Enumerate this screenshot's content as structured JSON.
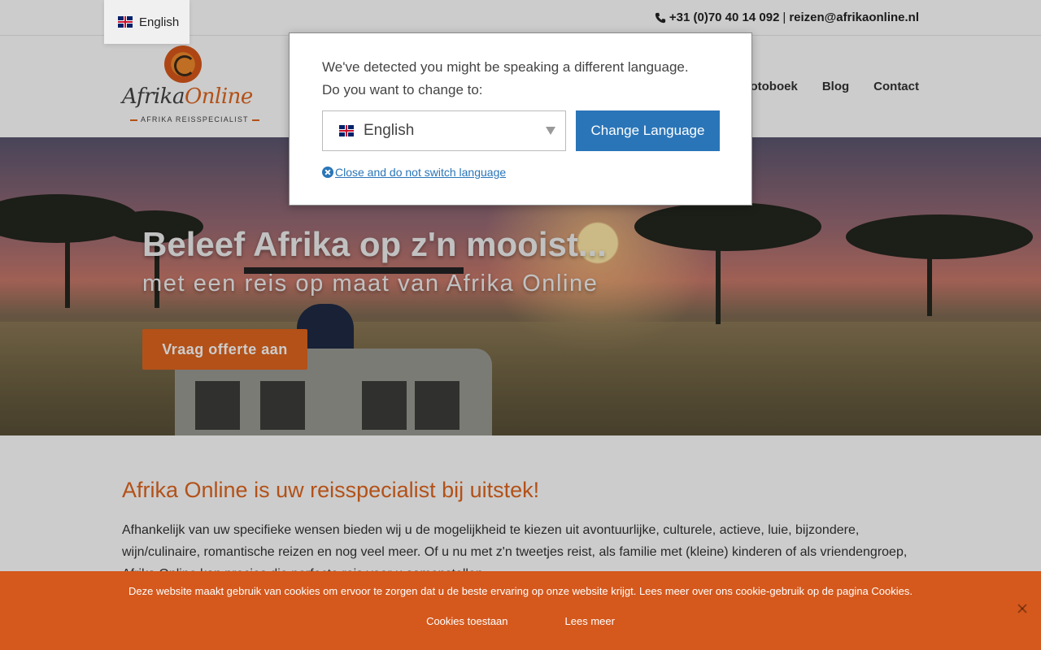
{
  "language_switcher": {
    "label": "English"
  },
  "topbar": {
    "phone": "+31 (0)70 40 14 092",
    "separator": "|",
    "email": "reizen@afrikaonline.nl"
  },
  "logo": {
    "name_part1": "Afrika",
    "name_part2": "Online",
    "tagline": "AFRIKA REISSPECIALIST"
  },
  "nav": {
    "items": [
      "otoboek",
      "Blog",
      "Contact"
    ]
  },
  "hero": {
    "title": "Beleef Afrika op z'n mooist...",
    "subtitle": "met een reis op maat van Afrika Online",
    "cta": "Vraag offerte aan"
  },
  "content": {
    "heading": "Afrika Online is uw reisspecialist bij uitstek!",
    "paragraph": "Afhankelijk van uw specifieke wensen bieden wij u de mogelijkheid te kiezen uit avontuurlijke, culturele, actieve, luie, bijzondere, wijn/culinaire, romantische reizen en nog veel meer. Of u nu met z'n tweetjes reist, als familie met (kleine) kinderen of als vriendengroep, Afrika Online kan precies die perfecte reis voor u samenstellen."
  },
  "language_modal": {
    "line1": "We've detected you might be speaking a different language.",
    "line2": "Do you want to change to:",
    "selected_language": "English",
    "change_button": "Change Language",
    "close_link": "Close and do not switch language"
  },
  "cookie_bar": {
    "text": "Deze website maakt gebruik van cookies om ervoor te zorgen dat u de beste ervaring op onze website krijgt. Lees meer over ons cookie-gebruik op de pagina Cookies.",
    "accept": "Cookies toestaan",
    "more": "Lees meer"
  },
  "colors": {
    "brand_orange": "#e0661f",
    "cookie_bg": "#d5581c",
    "modal_button": "#2a75b8"
  }
}
